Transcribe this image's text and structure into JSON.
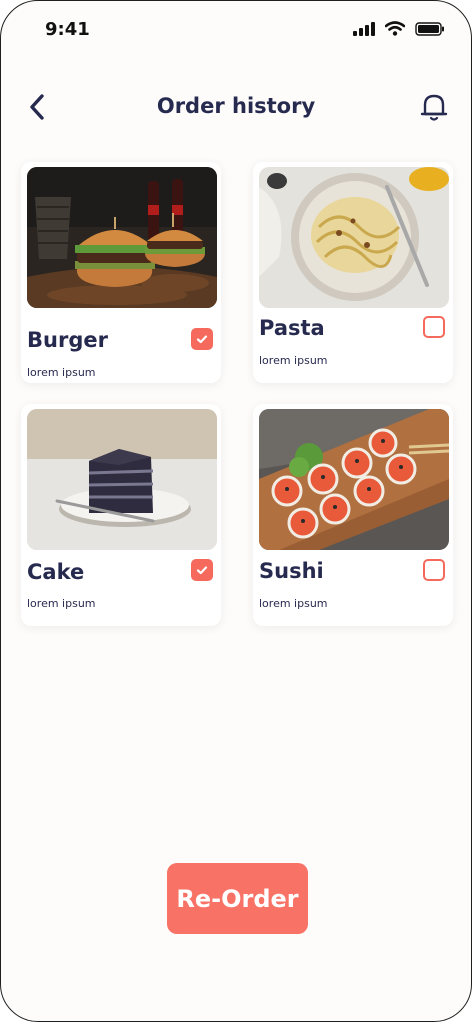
{
  "status_bar": {
    "time": "9:41"
  },
  "header": {
    "title": "Order history",
    "back_icon": "chevron-left-icon",
    "notification_icon": "bell-icon"
  },
  "orders": [
    {
      "name": "Burger",
      "subtitle": "lorem ipsum",
      "checked": true,
      "image": "burger-photo"
    },
    {
      "name": "Pasta",
      "subtitle": "lorem ipsum",
      "checked": false,
      "image": "pasta-photo"
    },
    {
      "name": "Cake",
      "subtitle": "lorem ipsum",
      "checked": true,
      "image": "cake-photo"
    },
    {
      "name": "Sushi",
      "subtitle": "lorem ipsum",
      "checked": false,
      "image": "sushi-photo"
    }
  ],
  "reorder_button": {
    "label": "Re-Order"
  },
  "colors": {
    "accent": "#f87266",
    "text": "#272a4f",
    "background": "#fdfcfb"
  }
}
